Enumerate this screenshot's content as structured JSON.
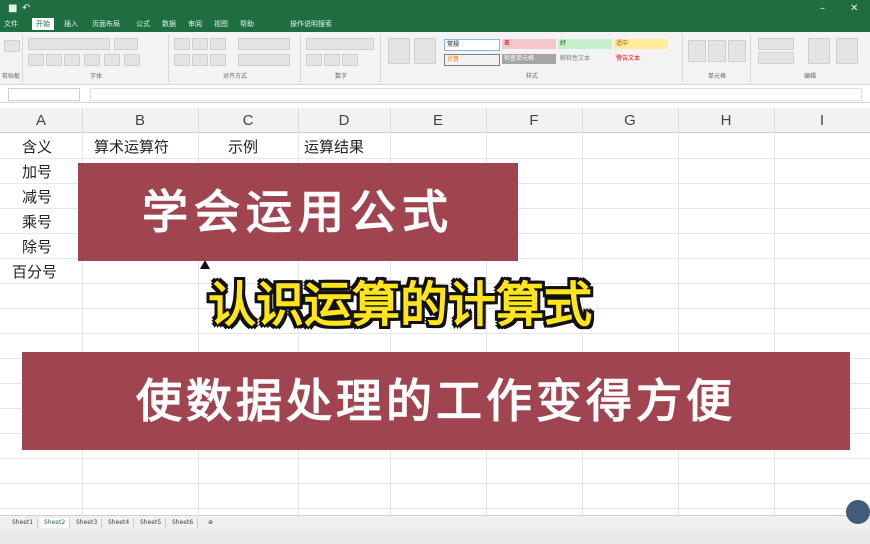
{
  "title_bar": {
    "title": "",
    "icons": [
      "save-icon",
      "undo-icon",
      "minimize-icon",
      "close-icon"
    ]
  },
  "ribbon_tabs": [
    "文件",
    "开始",
    "插入",
    "页面布局",
    "公式",
    "数据",
    "审阅",
    "视图",
    "帮助",
    "操作说明搜索"
  ],
  "ribbon_groups": [
    "剪贴板",
    "字体",
    "对齐方式",
    "数字",
    "样式",
    "单元格",
    "编辑"
  ],
  "style_cells": [
    {
      "label": "常规",
      "bg": "#ffffff"
    },
    {
      "label": "差",
      "bg": "#f4c7ce"
    },
    {
      "label": "好",
      "bg": "#c6efce"
    },
    {
      "label": "适中",
      "bg": "#ffeb9c"
    },
    {
      "label": "计算",
      "bg": "#f2f2f2"
    },
    {
      "label": "检查单元格",
      "bg": "#a5a5a5"
    },
    {
      "label": "解释性文本",
      "bg": "#ffffff"
    },
    {
      "label": "警告文本",
      "bg": "#ffffff"
    }
  ],
  "name_box": "",
  "formula_value": "",
  "columns": [
    "A",
    "B",
    "C",
    "D",
    "E",
    "F",
    "G",
    "H",
    "I"
  ],
  "cells": {
    "a1": "含义",
    "b1": "算术运算符",
    "c1": "示例",
    "d1": "运算结果",
    "a2": "加号",
    "a3": "减号",
    "a4": "乘号",
    "a5": "除号",
    "a6": "百分号"
  },
  "overlay": {
    "banner_top": "学会运用公式",
    "highlight": "认识运算的计算式",
    "banner_bottom": "使数据处理的工作变得方便"
  },
  "sheet_tabs": [
    "Sheet1",
    "Sheet2",
    "Sheet3",
    "Sheet4",
    "Sheet5",
    "Sheet6"
  ],
  "colors": {
    "excel_green": "#1e6e42",
    "banner_red": "#a04550",
    "highlight_yellow": "#ffe51a"
  }
}
